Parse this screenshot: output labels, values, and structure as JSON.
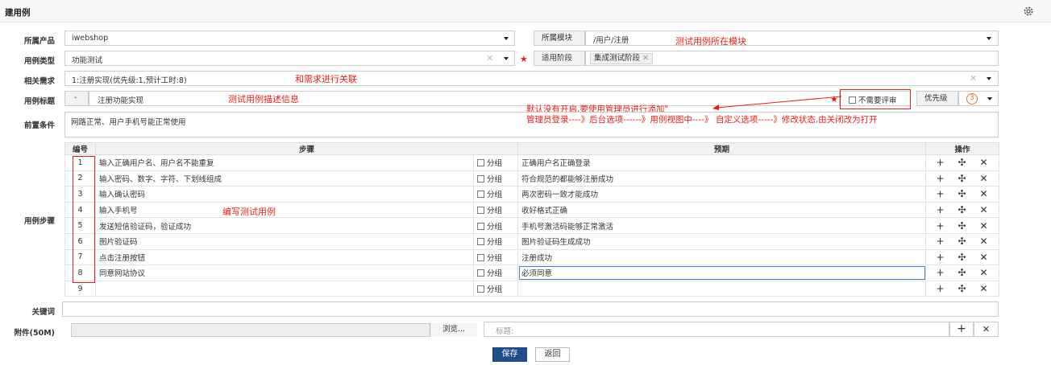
{
  "page_title": "建用例",
  "fields": {
    "product": {
      "label": "所属产品",
      "value": "iwebshop"
    },
    "module": {
      "label": "所属模块",
      "value": "/用户/注册"
    },
    "type": {
      "label": "用例类型",
      "value": "功能测试"
    },
    "stage": {
      "label": "适用阶段",
      "tag": "集成测试阶段"
    },
    "story": {
      "label": "相关需求",
      "value": "1:注册实现(优先级:1,预计工时:8)"
    },
    "title": {
      "label": "用例标题",
      "prefix": "-",
      "value": "注册功能实现",
      "review_label": "不需要评审",
      "priority_label": "优先级",
      "priority_value": "3"
    },
    "precondition": {
      "label": "前置条件",
      "value": "网路正常、用户手机号能正常使用"
    },
    "steps_label": "用例步骤",
    "keywords": {
      "label": "关键词",
      "value": ""
    },
    "files": {
      "label": "附件(50M)",
      "browse": "浏览...",
      "title_placeholder": "标题:"
    }
  },
  "annotations": {
    "module": "测试用例所在模块",
    "story": "和需求进行关联",
    "title": "测试用例描述信息",
    "review_line1": "默认没有开启,要使用管理员进行添加\"",
    "review_line2": "管理员登录----》后台选项------》用例视图中----》 自定义选项-----》修改状态,由关闭改为打开",
    "steps": "编写测试用例"
  },
  "steps_table": {
    "headers": {
      "num": "编号",
      "step": "步骤",
      "expect": "预期",
      "ops": "操作"
    },
    "group_label": "分组",
    "rows": [
      {
        "num": "1",
        "step": "输入正确用户名、用户名不能重复",
        "expect": "正确用户名正确登录"
      },
      {
        "num": "2",
        "step": "输入密码、数字、字符、下划线组成",
        "expect": "符合规范的都能够注册成功"
      },
      {
        "num": "3",
        "step": "输入确认密码",
        "expect": "两次密码一致才能成功"
      },
      {
        "num": "4",
        "step": "输入手机号",
        "expect": "收好格式正确"
      },
      {
        "num": "5",
        "step": "发送短信验证码，验证成功",
        "expect": "手机号激活码能够正常激活"
      },
      {
        "num": "6",
        "step": "图片验证码",
        "expect": "图片验证码生成成功"
      },
      {
        "num": "7",
        "step": "点击注册按钮",
        "expect": "注册成功"
      },
      {
        "num": "8",
        "step": "同意网站协议",
        "expect": "必须同意"
      },
      {
        "num": "9",
        "step": "",
        "expect": ""
      }
    ]
  },
  "buttons": {
    "save": "保存",
    "back": "返回"
  },
  "colors": {
    "annotation": "#e8201a",
    "save_bg": "#1f4e8f"
  },
  "icons": {
    "settings": "gear-icon",
    "add": "plus-icon",
    "move": "move-icon",
    "delete": "close-icon"
  }
}
